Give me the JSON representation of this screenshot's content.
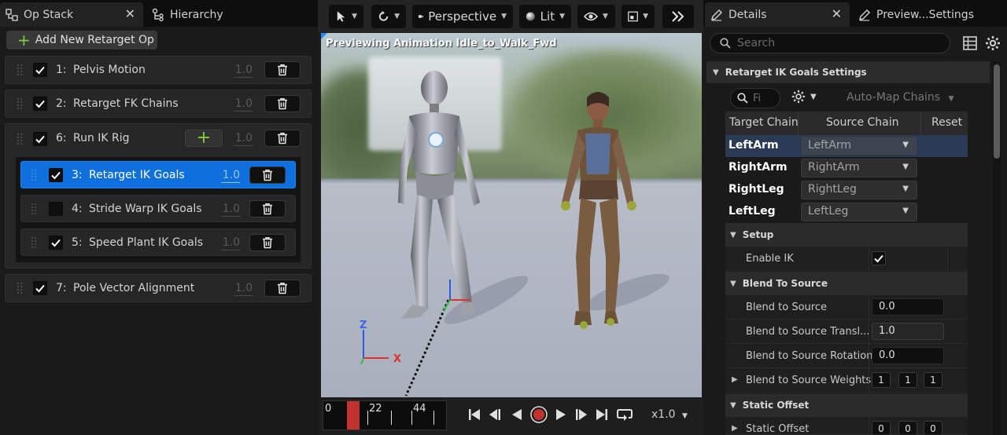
{
  "left": {
    "tabs": [
      {
        "label": "Op Stack",
        "close": "✕"
      },
      {
        "label": "Hierarchy"
      }
    ],
    "add_button": "Add New Retarget Op",
    "ops": [
      {
        "index": "1:",
        "label": "Pelvis Motion",
        "value": "1.0",
        "checked": true
      },
      {
        "index": "2:",
        "label": "Retarget FK Chains",
        "value": "1.0",
        "checked": true
      },
      {
        "index": "6:",
        "label": "Run IK Rig",
        "value": "1.0",
        "checked": true
      },
      {
        "index": "3:",
        "label": "Retarget IK Goals",
        "value": "1.0",
        "checked": true
      },
      {
        "index": "4:",
        "label": "Stride Warp IK Goals",
        "value": "1.0",
        "checked": false
      },
      {
        "index": "5:",
        "label": "Speed Plant IK Goals",
        "value": "1.0",
        "checked": true
      },
      {
        "index": "7:",
        "label": "Pole Vector Alignment",
        "value": "1.0",
        "checked": true
      }
    ]
  },
  "viewport": {
    "perspective": "Perspective",
    "lit": "Lit",
    "preview_text": "Previewing Animation Idle_to_Walk_Fwd",
    "gizmo": {
      "z": "Z",
      "x": "X"
    },
    "timeline": {
      "marks": [
        "0",
        "22",
        "44"
      ]
    },
    "speed": "x1.0"
  },
  "right": {
    "tabs": [
      {
        "label": "Details",
        "close": "✕"
      },
      {
        "label": "Preview...Settings"
      }
    ],
    "search_placeholder": "Search",
    "section_title": "Retarget IK Goals Settings",
    "filter_placeholder": "Fi",
    "auto_map": "Auto-Map Chains",
    "columns": [
      "Target Chain",
      "Source Chain",
      "Reset"
    ],
    "chains": [
      {
        "target": "LeftArm",
        "source": "LeftArm"
      },
      {
        "target": "RightArm",
        "source": "RightArm"
      },
      {
        "target": "RightLeg",
        "source": "RightLeg"
      },
      {
        "target": "LeftLeg",
        "source": "LeftLeg"
      }
    ],
    "setup": {
      "title": "Setup",
      "enable_ik_label": "Enable IK",
      "enable_ik": true
    },
    "blend": {
      "title": "Blend To Source",
      "rows": [
        {
          "label": "Blend to Source",
          "value": "0.0"
        },
        {
          "label": "Blend to Source Transl...",
          "value": "1.0"
        },
        {
          "label": "Blend to Source Rotation",
          "value": "0.0"
        }
      ],
      "weights_label": "Blend to Source Weights",
      "weights": [
        "1",
        "1",
        "1"
      ]
    },
    "static": {
      "title": "Static Offset",
      "row_label": "Static Offset",
      "values": [
        "0",
        "0",
        "0"
      ]
    }
  },
  "colors": {
    "accent": "#0f6fdc",
    "check": "#ffffff",
    "green": "#7dcf3c",
    "record": "#c1312f"
  }
}
